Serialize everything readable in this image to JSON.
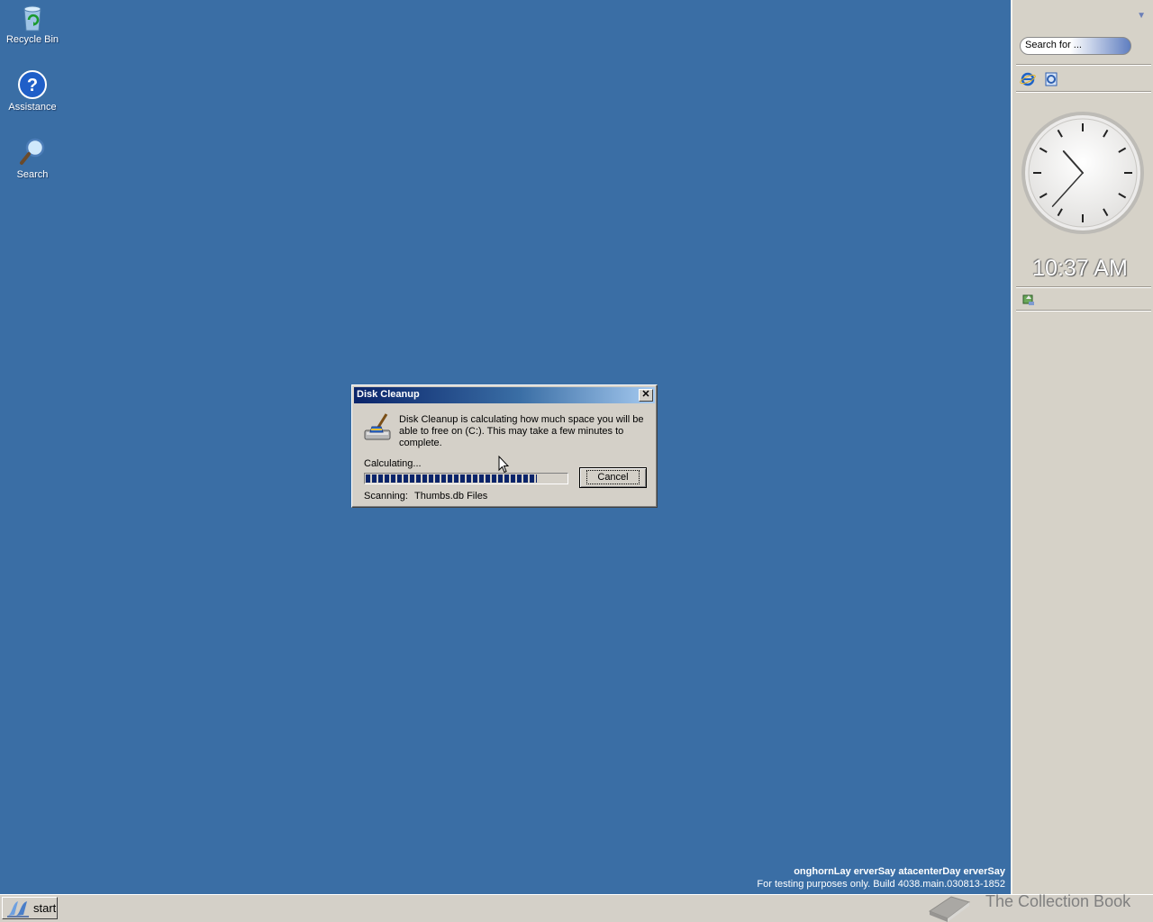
{
  "desktop": {
    "icons": [
      {
        "label": "Recycle Bin",
        "icon": "recycle-bin-icon"
      },
      {
        "label": "Assistance",
        "icon": "help-icon"
      },
      {
        "label": "Search",
        "icon": "search-icon"
      }
    ]
  },
  "sidebar": {
    "search_placeholder": "Search for ...",
    "clock_time": "10:37 AM",
    "clock": {
      "hour": 10,
      "minute": 37
    }
  },
  "dialog": {
    "title": "Disk Cleanup",
    "message": "Disk Cleanup is calculating how much space you will be able to free on  (C:). This may take a few minutes to complete.",
    "status": "Calculating...",
    "progress_fraction": 0.85,
    "cancel_label": "Cancel",
    "scanning_label": "Scanning:",
    "scanning_value": "Thumbs.db Files"
  },
  "watermark": {
    "line1": "onghornLay erverSay atacenterDay erverSay",
    "line2": "For testing purposes only. Build 4038.main.030813-1852"
  },
  "taskbar": {
    "start_label": "start",
    "brand": "The Collection Book"
  },
  "colors": {
    "desktop": "#3a6ea5",
    "title_bar_start": "#0a246a",
    "progress": "#0a246a"
  }
}
